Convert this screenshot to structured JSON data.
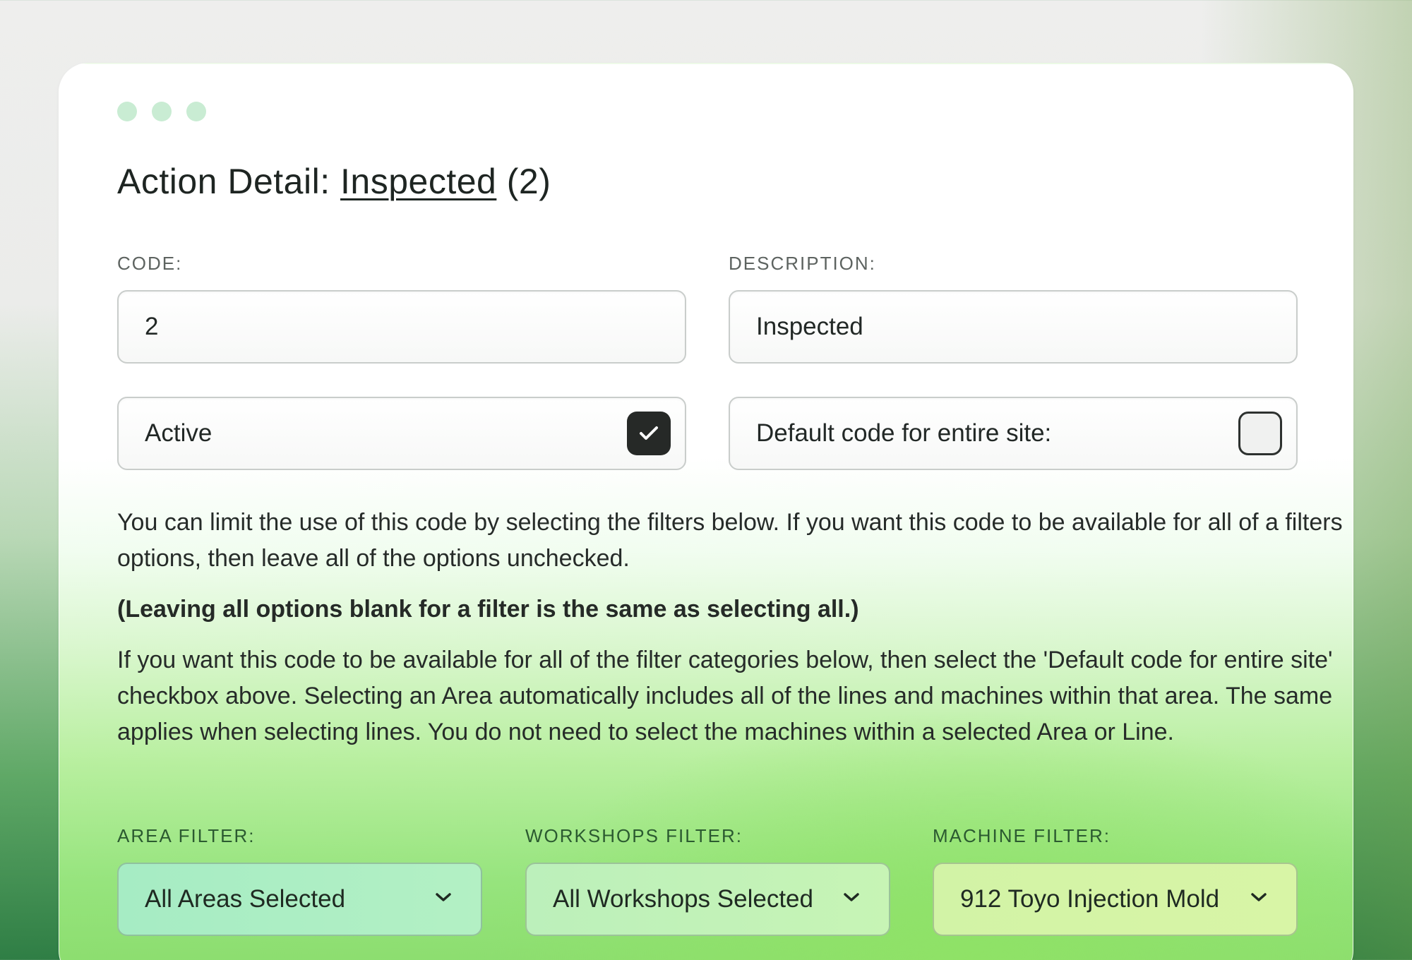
{
  "header": {
    "title_prefix": "Action Detail:",
    "title_link": "Inspected",
    "title_suffix": "(2)"
  },
  "form": {
    "code_label": "CODE:",
    "code_value": "2",
    "description_label": "DESCRIPTION:",
    "description_value": "Inspected",
    "active_label": "Active",
    "active_checked": true,
    "default_label": "Default code for entire site:",
    "default_checked": false
  },
  "help": {
    "paragraph1": "You can limit the use of this code by selecting the filters below. If you want this code to be available for all of a filters options, then leave all of the options unchecked.",
    "note": "(Leaving all options blank for a filter is the same as selecting all.)",
    "paragraph2": "If you want this code to be available for all of the filter categories below, then select the 'Default code for entire site' checkbox above. Selecting an Area automatically includes all of the lines and machines within that area. The same applies when selecting lines. You do not need to select the machines within a selected Area or Line."
  },
  "filters": {
    "area_label": "AREA FILTER:",
    "area_value": "All Areas Selected",
    "workshops_label": "WORKSHOPS FILTER:",
    "workshops_value": "All Workshops Selected",
    "machine_label": "MACHINE FILTER:",
    "machine_value": "912 Toyo Injection Mold"
  },
  "icons": {
    "window_dots": "window-dots-icon",
    "checkmark": "checkmark-icon",
    "chevron": "chevron-down-icon"
  },
  "colors": {
    "window_dot": "#c9ecd3",
    "checkbox_on": "#262927",
    "filter_label": "#2b5a30"
  }
}
